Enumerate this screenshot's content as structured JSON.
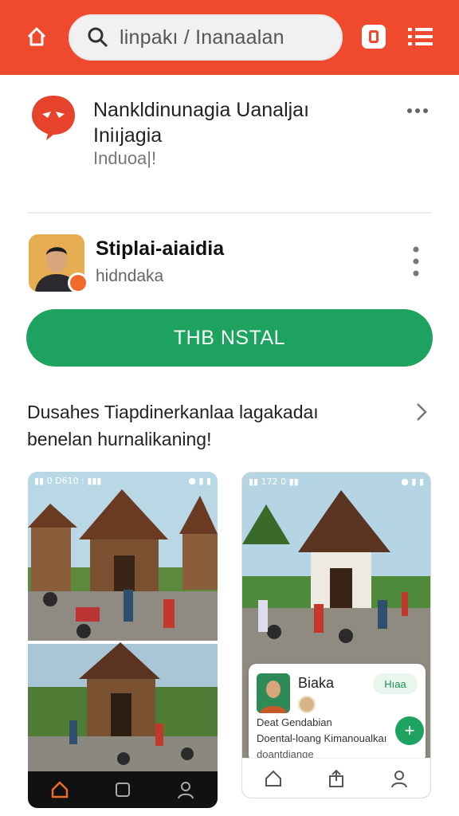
{
  "colors": {
    "accent": "#ef4a2e",
    "install": "#1ea260",
    "text": "#222222"
  },
  "topbar": {
    "search_query": "linpakı / Inanaalan",
    "home_icon": "home-icon",
    "search_icon": "search-icon",
    "badge_icon": "badge-icon",
    "menu_icon": "menu-icon"
  },
  "app": {
    "title_line1": "Nankldinunagia Uanaljaı",
    "title_line2": "Iniıjagia",
    "subtitle": "Induoa|!",
    "more_icon": "more-horizontal-icon"
  },
  "developer": {
    "name": "Stiplai-aiaidia",
    "subtitle": "hidndaka",
    "more_icon": "more-vertical-icon"
  },
  "install_label": "THB NSTAL",
  "description": {
    "line1": "Dusahes Tiapdinerkanlaa lagakadaı",
    "line2": "benelan hurnalikaning!"
  },
  "screenshot1": {
    "status_left": "▮▮ 0 D610 : ▮▮▮",
    "status_right": "● ▮ ▮"
  },
  "screenshot2": {
    "status_left": "▮▮ 172 0 ▮▮",
    "status_right": "● ▮ ▮",
    "card_title": "Biaka",
    "card_chip": "Hıaa",
    "card_line1": "Deat Gendabian",
    "card_line2": "Doental-loang Kimanoualkaı",
    "card_line3": "doantdiange"
  }
}
